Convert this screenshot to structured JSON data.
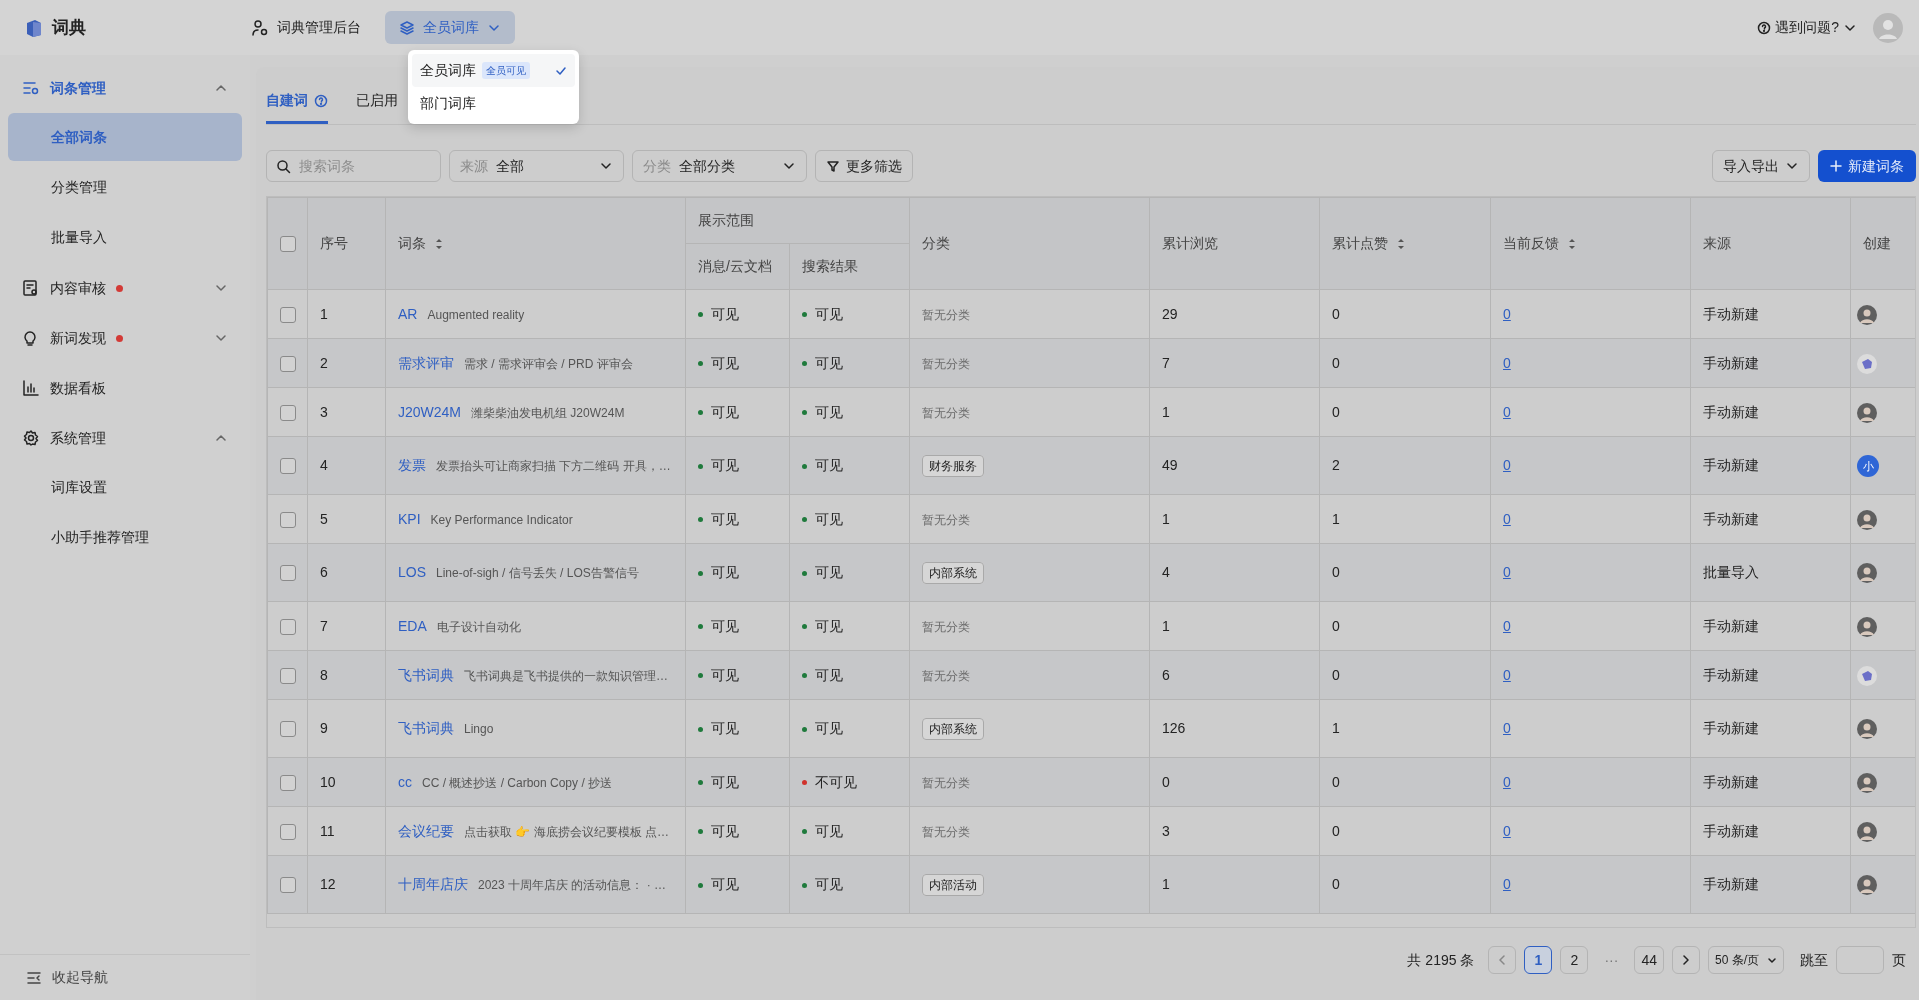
{
  "app": {
    "title": "词典"
  },
  "header": {
    "admin_link": "词典管理后台",
    "library_button": {
      "label": "全员词库",
      "expanded": true
    },
    "help": "遇到问题?"
  },
  "library_menu": [
    {
      "label": "全员词库",
      "badge": "全员可见",
      "selected": true
    },
    {
      "label": "部门词库",
      "selected": false
    }
  ],
  "sidebar": {
    "groups": [
      {
        "label": "词条管理",
        "kind": "list",
        "expanded": true,
        "alert": false,
        "children": [
          {
            "label": "全部词条",
            "selected": true
          },
          {
            "label": "分类管理",
            "selected": false
          },
          {
            "label": "批量导入",
            "selected": false
          }
        ]
      },
      {
        "label": "内容审核",
        "kind": "review",
        "expanded": false,
        "alert": true
      },
      {
        "label": "新词发现",
        "kind": "bulb",
        "expanded": false,
        "alert": true
      },
      {
        "label": "数据看板",
        "kind": "chart",
        "alert": false
      },
      {
        "label": "系统管理",
        "kind": "gear",
        "expanded": true,
        "alert": false,
        "children": [
          {
            "label": "词库设置",
            "selected": false
          },
          {
            "label": "小助手推荐管理",
            "selected": false
          }
        ]
      }
    ],
    "collapse": "收起导航"
  },
  "tabs": [
    {
      "label": "自建词",
      "selected": true,
      "help": true
    },
    {
      "label": "已启用",
      "selected": false,
      "help": false
    }
  ],
  "filters": {
    "search_placeholder": "搜索词条",
    "source": {
      "label": "来源",
      "value": "全部"
    },
    "category": {
      "label": "分类",
      "value": "全部分类"
    },
    "more": "更多筛选",
    "import_export": "导入导出",
    "create": "新建词条"
  },
  "table": {
    "select_all": false,
    "columns": [
      {
        "label": "序号",
        "sortable": false
      },
      {
        "label": "词条",
        "sortable": true
      },
      {
        "label": "展示范围",
        "children": [
          "消息/云文档",
          "搜索结果"
        ]
      },
      {
        "label": "分类",
        "sortable": false
      },
      {
        "label": "累计浏览",
        "sortable": false
      },
      {
        "label": "累计点赞",
        "sortable": true
      },
      {
        "label": "当前反馈",
        "sortable": true
      },
      {
        "label": "来源",
        "sortable": false
      },
      {
        "label": "创建",
        "sortable": false
      }
    ],
    "rows": [
      {
        "index": "1",
        "term": "AR",
        "description": "Augmented reality",
        "checked": false,
        "msg": {
          "text": "可见",
          "visible": true
        },
        "search": {
          "text": "可见",
          "visible": true
        },
        "category": {
          "text": "暂无分类",
          "kind": "none"
        },
        "views": "29",
        "likes": "0",
        "feedback": "0",
        "source": "手动新建",
        "creator": {
          "kind": "photo"
        }
      },
      {
        "index": "2",
        "term": "需求评审",
        "description": "需求 / 需求评审会 / PRD 评审会",
        "checked": false,
        "msg": {
          "text": "可见",
          "visible": true
        },
        "search": {
          "text": "可见",
          "visible": true
        },
        "category": {
          "text": "暂无分类",
          "kind": "none"
        },
        "views": "7",
        "likes": "0",
        "feedback": "0",
        "source": "手动新建",
        "creator": {
          "kind": "logo"
        }
      },
      {
        "index": "3",
        "term": "J20W24M",
        "description": "潍柴柴油发电机组 J20W24M",
        "checked": false,
        "msg": {
          "text": "可见",
          "visible": true
        },
        "search": {
          "text": "可见",
          "visible": true
        },
        "category": {
          "text": "暂无分类",
          "kind": "none"
        },
        "views": "1",
        "likes": "0",
        "feedback": "0",
        "source": "手动新建",
        "creator": {
          "kind": "photo"
        }
      },
      {
        "index": "4",
        "term": "发票",
        "description": "发票抬头可让商家扫描 下方二维码 开具，…",
        "checked": false,
        "msg": {
          "text": "可见",
          "visible": true
        },
        "search": {
          "text": "可见",
          "visible": true
        },
        "category": {
          "text": "财务服务",
          "kind": "tag"
        },
        "views": "49",
        "likes": "2",
        "feedback": "0",
        "source": "手动新建",
        "creator": {
          "kind": "initials",
          "text": "小"
        }
      },
      {
        "index": "5",
        "term": "KPI",
        "description": "Key Performance Indicator",
        "checked": false,
        "msg": {
          "text": "可见",
          "visible": true
        },
        "search": {
          "text": "可见",
          "visible": true
        },
        "category": {
          "text": "暂无分类",
          "kind": "none"
        },
        "views": "1",
        "likes": "1",
        "feedback": "0",
        "source": "手动新建",
        "creator": {
          "kind": "photo"
        }
      },
      {
        "index": "6",
        "term": "LOS",
        "description": "Line-of-sigh / 信号丢失 / LOS告警信号",
        "checked": false,
        "msg": {
          "text": "可见",
          "visible": true
        },
        "search": {
          "text": "可见",
          "visible": true
        },
        "category": {
          "text": "内部系统",
          "kind": "tag"
        },
        "views": "4",
        "likes": "0",
        "feedback": "0",
        "source": "批量导入",
        "creator": {
          "kind": "photo"
        }
      },
      {
        "index": "7",
        "term": "EDA",
        "description": "电子设计自动化",
        "checked": false,
        "msg": {
          "text": "可见",
          "visible": true
        },
        "search": {
          "text": "可见",
          "visible": true
        },
        "category": {
          "text": "暂无分类",
          "kind": "none"
        },
        "views": "1",
        "likes": "0",
        "feedback": "0",
        "source": "手动新建",
        "creator": {
          "kind": "photo"
        }
      },
      {
        "index": "8",
        "term": "飞书词典",
        "description": "飞书词典是飞书提供的一款知识管理…",
        "checked": false,
        "msg": {
          "text": "可见",
          "visible": true
        },
        "search": {
          "text": "可见",
          "visible": true
        },
        "category": {
          "text": "暂无分类",
          "kind": "none"
        },
        "views": "6",
        "likes": "0",
        "feedback": "0",
        "source": "手动新建",
        "creator": {
          "kind": "logo"
        }
      },
      {
        "index": "9",
        "term": "飞书词典",
        "description": "Lingo",
        "checked": false,
        "msg": {
          "text": "可见",
          "visible": true
        },
        "search": {
          "text": "可见",
          "visible": true
        },
        "category": {
          "text": "内部系统",
          "kind": "tag"
        },
        "views": "126",
        "likes": "1",
        "feedback": "0",
        "source": "手动新建",
        "creator": {
          "kind": "photo"
        }
      },
      {
        "index": "10",
        "term": "cc",
        "description": "CC / 概述抄送 / Carbon Copy / 抄送",
        "checked": false,
        "msg": {
          "text": "可见",
          "visible": true
        },
        "search": {
          "text": "不可见",
          "visible": false
        },
        "category": {
          "text": "暂无分类",
          "kind": "none"
        },
        "views": "0",
        "likes": "0",
        "feedback": "0",
        "source": "手动新建",
        "creator": {
          "kind": "photo"
        }
      },
      {
        "index": "11",
        "term": "会议纪要",
        "description": "点击获取 👉 海底捞会议纪要模板 点…",
        "checked": false,
        "msg": {
          "text": "可见",
          "visible": true
        },
        "search": {
          "text": "可见",
          "visible": true
        },
        "category": {
          "text": "暂无分类",
          "kind": "none"
        },
        "views": "3",
        "likes": "0",
        "feedback": "0",
        "source": "手动新建",
        "creator": {
          "kind": "photo"
        }
      },
      {
        "index": "12",
        "term": "十周年店庆",
        "description": "2023 十周年店庆 的活动信息： · …",
        "checked": false,
        "msg": {
          "text": "可见",
          "visible": true
        },
        "search": {
          "text": "可见",
          "visible": true
        },
        "category": {
          "text": "内部活动",
          "kind": "tag"
        },
        "views": "1",
        "likes": "0",
        "feedback": "0",
        "source": "手动新建",
        "creator": {
          "kind": "photo"
        }
      }
    ]
  },
  "pagination": {
    "total": "共 2195 条",
    "pages": [
      {
        "label": "1",
        "kind": "page",
        "selected": true
      },
      {
        "label": "2",
        "kind": "page",
        "selected": false
      },
      {
        "label": "···",
        "kind": "ellipsis"
      },
      {
        "label": "44",
        "kind": "page",
        "selected": false
      }
    ],
    "page_size": "50 条/页",
    "jump_label": "跳至",
    "jump_suffix": "页"
  }
}
